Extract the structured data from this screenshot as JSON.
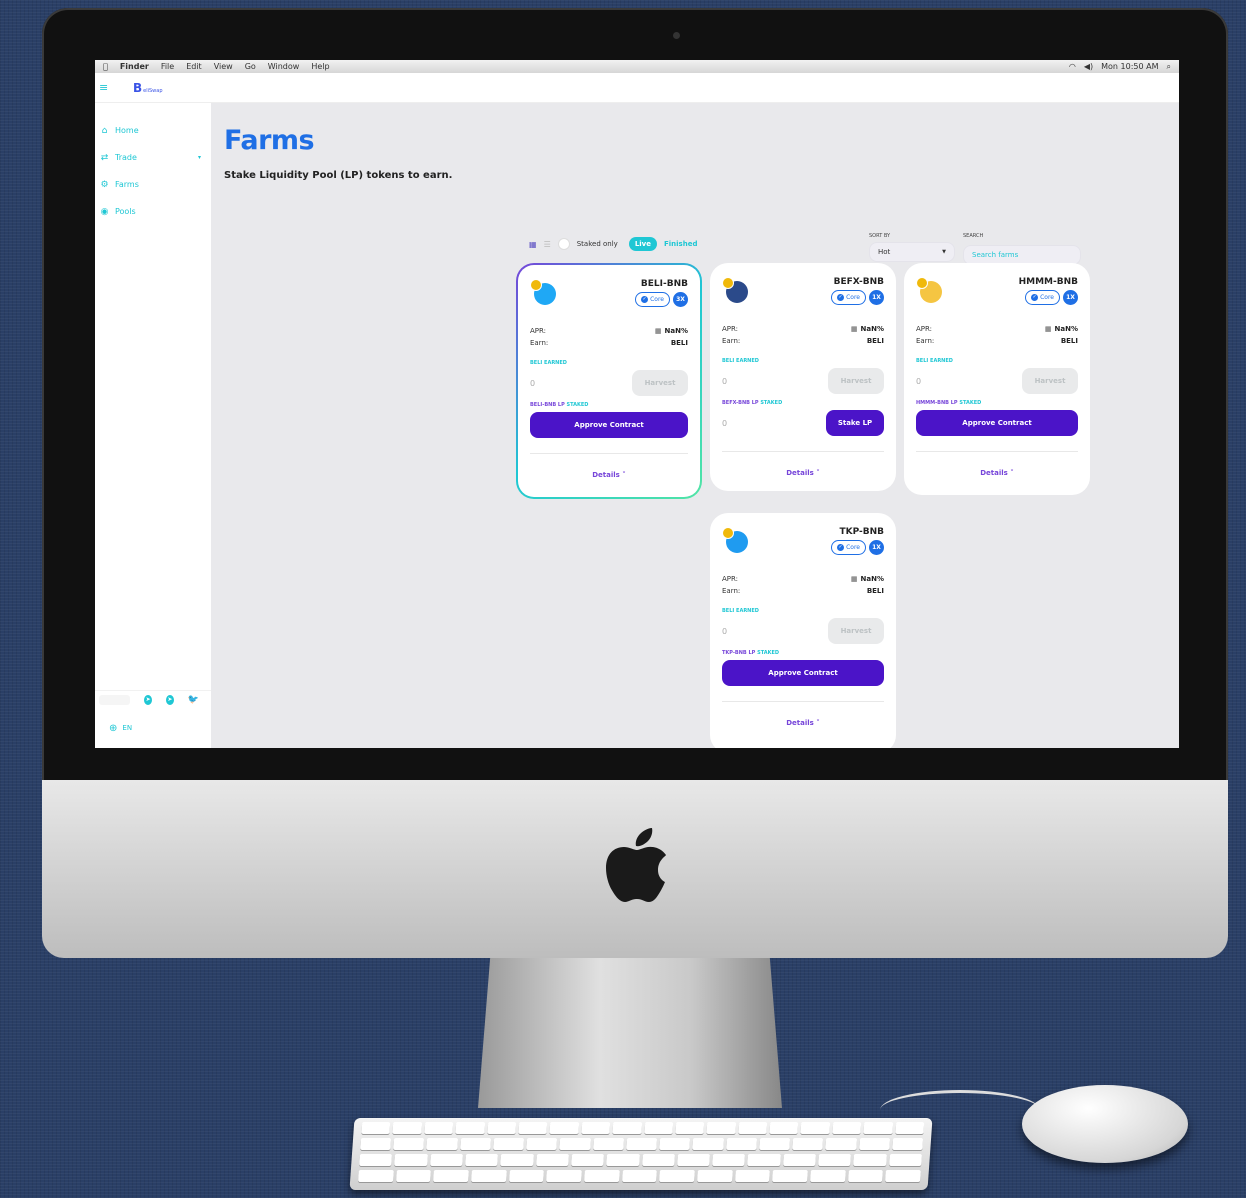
{
  "menubar": {
    "apple": "",
    "items": [
      "Finder",
      "File",
      "Edit",
      "View",
      "Go",
      "Window",
      "Help"
    ],
    "clock": "Mon 10:50 AM"
  },
  "app": {
    "logo_text": "B",
    "logo_small": "eliSwap"
  },
  "sidebar": {
    "items": [
      {
        "label": "Home",
        "icon": "home-icon"
      },
      {
        "label": "Trade",
        "icon": "swap-icon"
      },
      {
        "label": "Farms",
        "icon": "tractor-icon"
      },
      {
        "label": "Pools",
        "icon": "pool-icon"
      }
    ],
    "lang": "EN"
  },
  "page": {
    "title": "Farms",
    "subtitle": "Stake Liquidity Pool (LP) tokens to earn."
  },
  "controls": {
    "staked_only": "Staked only",
    "tab_live": "Live",
    "tab_finished": "Finished",
    "sort_label": "SORT BY",
    "sort_value": "Hot",
    "search_label": "SEARCH",
    "search_placeholder": "Search farms"
  },
  "farms": [
    {
      "pair": "BELI-BNB",
      "core": "Core",
      "multiplier": "3X",
      "apr_label": "APR:",
      "apr": "NaN%",
      "earn_label": "Earn:",
      "earn": "BELI",
      "earned_token": "BELI",
      "earned_suffix": "EARNED",
      "earned_value": "0",
      "harvest": "Harvest",
      "staked_token": "BELI-BNB LP",
      "staked_suffix": "STAKED",
      "action": "Approve Contract",
      "details": "Details ˅",
      "icon_color": "#1fa8f5"
    },
    {
      "pair": "BEFX-BNB",
      "core": "Core",
      "multiplier": "1X",
      "apr_label": "APR:",
      "apr": "NaN%",
      "earn_label": "Earn:",
      "earn": "BELI",
      "earned_token": "BELI",
      "earned_suffix": "EARNED",
      "earned_value": "0",
      "harvest": "Harvest",
      "staked_token": "BEFX-BNB LP",
      "staked_suffix": "STAKED",
      "staked_value": "0",
      "action": "Stake LP",
      "details": "Details ˅",
      "icon_color": "#2b4a8a"
    },
    {
      "pair": "HMMM-BNB",
      "core": "Core",
      "multiplier": "1X",
      "apr_label": "APR:",
      "apr": "NaN%",
      "earn_label": "Earn:",
      "earn": "BELI",
      "earned_token": "BELI",
      "earned_suffix": "EARNED",
      "earned_value": "0",
      "harvest": "Harvest",
      "staked_token": "HMMM-BNB LP",
      "staked_suffix": "STAKED",
      "action": "Approve Contract",
      "details": "Details ˅",
      "icon_color": "#f5c542"
    },
    {
      "pair": "TKP-BNB",
      "core": "Core",
      "multiplier": "1X",
      "apr_label": "APR:",
      "apr": "NaN%",
      "earn_label": "Earn:",
      "earn": "BELI",
      "earned_token": "BELI",
      "earned_suffix": "EARNED",
      "earned_value": "0",
      "harvest": "Harvest",
      "staked_token": "TKP-BNB LP",
      "staked_suffix": "STAKED",
      "action": "Approve Contract",
      "details": "Details ˅",
      "icon_color": "#1f9bf0"
    }
  ]
}
